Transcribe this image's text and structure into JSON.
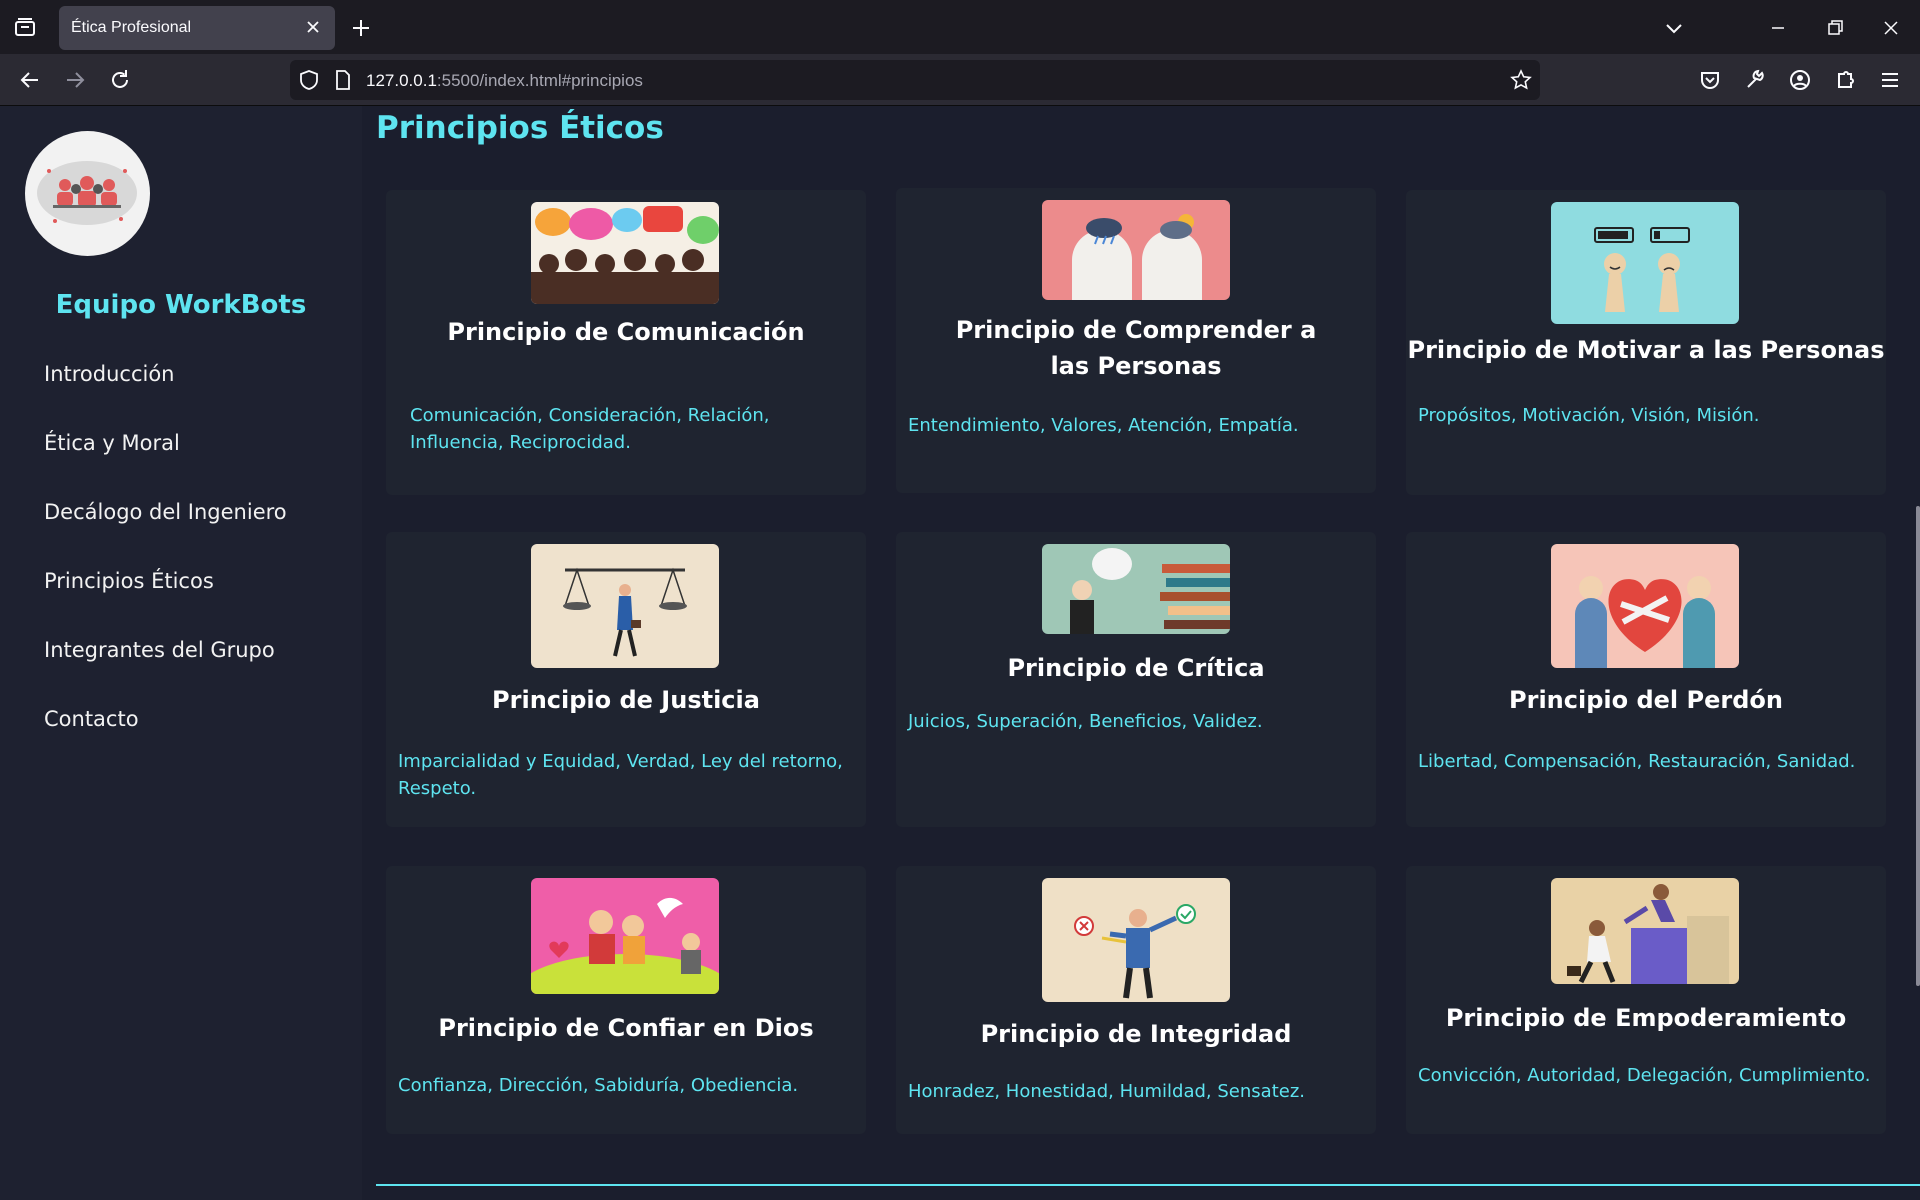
{
  "browser": {
    "tab_title": "Ética Profesional",
    "url_host": "127.0.0.1",
    "url_rest": ":5500/index.html#principios"
  },
  "sidebar": {
    "team_name": "Equipo WorkBots",
    "items": [
      {
        "label": "Introducción"
      },
      {
        "label": "Ética y Moral"
      },
      {
        "label": "Decálogo del Ingeniero"
      },
      {
        "label": "Principios Éticos"
      },
      {
        "label": "Integrantes del Grupo"
      },
      {
        "label": "Contacto"
      }
    ]
  },
  "main": {
    "section_title": "Principios Éticos",
    "cards": [
      {
        "title": "Principio de Comunicación",
        "desc": "Comunicación, Consideración, Relación, Influencia, Reciprocidad."
      },
      {
        "title": "Principio de Comprender a las Personas",
        "desc": "Entendimiento, Valores, Atención, Empatía."
      },
      {
        "title": "Principio de Motivar a las Personas",
        "desc": "Propósitos, Motivación, Visión, Misión."
      },
      {
        "title": "Principio de Justicia",
        "desc": "Imparcialidad y Equidad, Verdad, Ley del retorno, Respeto."
      },
      {
        "title": "Principio de Crítica",
        "desc": "Juicios, Superación, Beneficios, Validez."
      },
      {
        "title": "Principio del Perdón",
        "desc": "Libertad, Compensación, Restauración, Sanidad."
      },
      {
        "title": "Principio de Confiar en Dios",
        "desc": "Confianza, Dirección, Sabiduría, Obediencia."
      },
      {
        "title": "Principio de Integridad",
        "desc": "Honradez, Honestidad, Humildad, Sensatez."
      },
      {
        "title": "Principio de Empoderamiento",
        "desc": "Convicción, Autoridad, Delegación, Cumplimiento."
      }
    ]
  },
  "colors": {
    "accent": "#5ee4f0",
    "background": "#1b1e2d",
    "card": "#1f2430"
  }
}
